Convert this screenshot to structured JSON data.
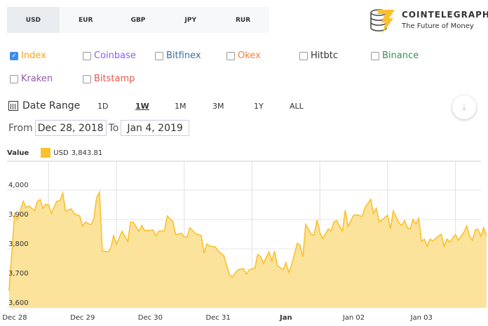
{
  "currency_tabs": [
    {
      "label": "USD",
      "active": true
    },
    {
      "label": "EUR"
    },
    {
      "label": "GBP"
    },
    {
      "label": "JPY"
    },
    {
      "label": "RUR"
    }
  ],
  "logo": {
    "name": "COINTELEGRAPH",
    "tagline": "The Future of Money"
  },
  "exchanges": [
    {
      "label": "Index",
      "checked": true,
      "color": "#f5a623"
    },
    {
      "label": "Coinbase",
      "checked": false,
      "color": "#8b5cf6"
    },
    {
      "label": "Bitfinex",
      "checked": false,
      "color": "#3a6ea5"
    },
    {
      "label": "Okex",
      "checked": false,
      "color": "#f5813c"
    },
    {
      "label": "Hitbtc",
      "checked": false,
      "color": "#333333"
    },
    {
      "label": "Binance",
      "checked": false,
      "color": "#3d8b4e"
    },
    {
      "label": "Kraken",
      "checked": false,
      "color": "#8e5aa8"
    },
    {
      "label": "Bitstamp",
      "checked": false,
      "color": "#e8554e"
    }
  ],
  "date_range": {
    "label": "Date Range",
    "options": [
      "1D",
      "1W",
      "1M",
      "3M",
      "1Y",
      "ALL"
    ],
    "selected": "1W"
  },
  "from_label": "From",
  "from_value": "Dec 28, 2018",
  "to_label": "To",
  "to_value": "Jan 4, 2019",
  "legend": {
    "title": "Value",
    "series": "USD",
    "value": "3,843.81"
  },
  "chart_data": {
    "type": "area",
    "color": "#fbc02d",
    "fill": "#fbe39b",
    "ylim": [
      3600,
      4050
    ],
    "yticks": [
      "3,600",
      "3,700",
      "3,800",
      "3,900",
      "4,000"
    ],
    "ytick_values": [
      3600,
      3700,
      3800,
      3900,
      4000
    ],
    "xticks": [
      "Dec 28",
      "Dec 29",
      "Dec 30",
      "Dec 31",
      "Jan",
      "Jan 02",
      "Jan 03"
    ],
    "grid": true,
    "series": {
      "name": "USD",
      "points_by_day_hour": {
        "2018-12-27": [
          [
            22,
            3658
          ]
        ],
        "2018-12-28": [
          [
            0,
            3920
          ],
          [
            1,
            3900
          ],
          [
            3,
            3962
          ],
          [
            4,
            3940
          ],
          [
            5,
            3946
          ],
          [
            7,
            3930
          ],
          [
            8,
            3960
          ],
          [
            9,
            3968
          ],
          [
            10,
            3937
          ],
          [
            11,
            3952
          ],
          [
            12,
            3949
          ],
          [
            13,
            3920
          ],
          [
            14,
            3944
          ],
          [
            15,
            3963
          ],
          [
            16,
            3963
          ],
          [
            17,
            3989
          ],
          [
            18,
            3928
          ],
          [
            20,
            3936
          ],
          [
            21,
            3920
          ],
          [
            23,
            3912
          ]
        ],
        "2018-12-29": [
          [
            0,
            3878
          ],
          [
            1,
            3891
          ],
          [
            3,
            3882
          ],
          [
            4,
            3902
          ],
          [
            5,
            3974
          ],
          [
            6,
            3993
          ],
          [
            7,
            3793
          ],
          [
            9,
            3790
          ],
          [
            10,
            3802
          ],
          [
            11,
            3845
          ],
          [
            12,
            3815
          ],
          [
            14,
            3860
          ],
          [
            16,
            3825
          ],
          [
            17,
            3892
          ],
          [
            18,
            3890
          ],
          [
            20,
            3860
          ],
          [
            21,
            3880
          ],
          [
            22,
            3862
          ]
        ],
        "2018-12-30": [
          [
            1,
            3864
          ],
          [
            2,
            3844
          ],
          [
            3,
            3861
          ],
          [
            5,
            3861
          ],
          [
            6,
            3912
          ],
          [
            8,
            3892
          ],
          [
            9,
            3848
          ],
          [
            11,
            3853
          ],
          [
            12,
            3840
          ],
          [
            13,
            3840
          ],
          [
            14,
            3872
          ],
          [
            16,
            3852
          ],
          [
            18,
            3846
          ],
          [
            19,
            3785
          ],
          [
            20,
            3817
          ],
          [
            21,
            3809
          ],
          [
            23,
            3807
          ]
        ],
        "2018-12-31": [
          [
            0,
            3793
          ],
          [
            2,
            3777
          ],
          [
            4,
            3713
          ],
          [
            5,
            3704
          ],
          [
            7,
            3729
          ],
          [
            9,
            3733
          ],
          [
            10,
            3714
          ],
          [
            11,
            3729
          ],
          [
            13,
            3735
          ],
          [
            14,
            3781
          ],
          [
            15,
            3775
          ],
          [
            16,
            3751
          ],
          [
            18,
            3790
          ],
          [
            19,
            3760
          ],
          [
            20,
            3792
          ],
          [
            21,
            3743
          ],
          [
            23,
            3729
          ]
        ],
        "2019-01-01": [
          [
            0,
            3753
          ],
          [
            1,
            3720
          ],
          [
            2,
            3745
          ],
          [
            4,
            3819
          ],
          [
            5,
            3812
          ],
          [
            6,
            3773
          ],
          [
            7,
            3883
          ],
          [
            9,
            3848
          ],
          [
            10,
            3848
          ],
          [
            11,
            3898
          ],
          [
            12,
            3856
          ],
          [
            13,
            3835
          ],
          [
            15,
            3868
          ],
          [
            16,
            3861
          ],
          [
            17,
            3892
          ],
          [
            18,
            3896
          ],
          [
            20,
            3860
          ],
          [
            21,
            3932
          ],
          [
            22,
            3876
          ]
        ],
        "2019-01-02": [
          [
            0,
            3914
          ],
          [
            1,
            3916
          ],
          [
            3,
            3910
          ],
          [
            4,
            3940
          ],
          [
            6,
            3968
          ],
          [
            7,
            3920
          ],
          [
            8,
            3938
          ],
          [
            9,
            3891
          ],
          [
            12,
            3914
          ],
          [
            13,
            3868
          ],
          [
            14,
            3929
          ],
          [
            16,
            3888
          ],
          [
            17,
            3880
          ],
          [
            18,
            3896
          ],
          [
            19,
            3872
          ],
          [
            20,
            3868
          ],
          [
            21,
            3900
          ],
          [
            22,
            3884
          ],
          [
            23,
            3903
          ]
        ],
        "2019-01-03": [
          [
            0,
            3825
          ],
          [
            1,
            3833
          ],
          [
            2,
            3809
          ],
          [
            3,
            3833
          ],
          [
            4,
            3827
          ],
          [
            6,
            3844
          ],
          [
            7,
            3850
          ],
          [
            8,
            3809
          ],
          [
            9,
            3833
          ],
          [
            10,
            3823
          ],
          [
            12,
            3848
          ],
          [
            13,
            3829
          ],
          [
            15,
            3856
          ],
          [
            16,
            3878
          ],
          [
            17,
            3844
          ],
          [
            18,
            3829
          ],
          [
            19,
            3864
          ],
          [
            20,
            3867
          ],
          [
            21,
            3843
          ],
          [
            22,
            3872
          ],
          [
            23,
            3843.81
          ]
        ]
      }
    }
  }
}
